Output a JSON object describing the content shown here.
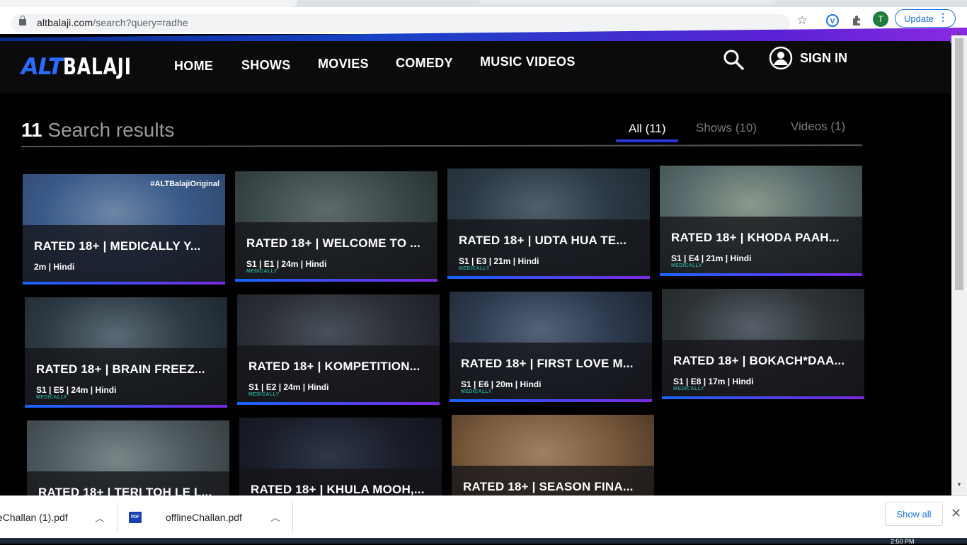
{
  "browser": {
    "url_domain": "altbalaji.com",
    "url_path": "/search?query=radhe",
    "profile_initial": "T",
    "update_label": "Update",
    "menu_dots": "⋮"
  },
  "site": {
    "logo_alt": "ALT",
    "logo_balaji": "BALAJI",
    "nav": [
      "HOME",
      "SHOWS",
      "MOVIES",
      "COMEDY",
      "MUSIC VIDEOS"
    ],
    "sign_in": "SIGN IN"
  },
  "results": {
    "count": "11",
    "label": "Search results",
    "tabs": [
      "All (11)",
      "Shows (10)",
      "Videos (1)"
    ]
  },
  "cards": [
    {
      "title": "RATED 18+ | MEDICALLY Y...",
      "meta": "2m | Hindi",
      "hashtag": "#ALTBalajiOriginal",
      "ribbon": ""
    },
    {
      "title": "RATED 18+ | WELCOME TO ...",
      "meta": "S1 | E1 | 24m | Hindi",
      "hashtag": "",
      "ribbon": "MEDICALLY"
    },
    {
      "title": "RATED 18+ | UDTA HUA TE...",
      "meta": "S1 | E3 | 21m | Hindi",
      "hashtag": "",
      "ribbon": "MEDICALLY"
    },
    {
      "title": "RATED 18+ | KHODA PAAH...",
      "meta": "S1 | E4 | 21m | Hindi",
      "hashtag": "",
      "ribbon": "MEDICALLY"
    },
    {
      "title": "RATED 18+ | BRAIN FREEZ...",
      "meta": "S1 | E5 | 24m | Hindi",
      "hashtag": "",
      "ribbon": "MEDICALLY"
    },
    {
      "title": "RATED 18+ | KOMPETITION...",
      "meta": "S1 | E2 | 24m | Hindi",
      "hashtag": "",
      "ribbon": "MEDICALLY"
    },
    {
      "title": "RATED 18+ | FIRST LOVE M...",
      "meta": "S1 | E6 | 20m | Hindi",
      "hashtag": "",
      "ribbon": "MEDICALLY"
    },
    {
      "title": "RATED 18+ | BOKACH*DAA...",
      "meta": "S1 | E8 | 17m | Hindi",
      "hashtag": "",
      "ribbon": "MEDICALLY"
    },
    {
      "title": "RATED 18+ | TERI TOH LE L...",
      "meta": "",
      "hashtag": "",
      "ribbon": ""
    },
    {
      "title": "RATED 18+ | KHULA MOOH,...",
      "meta": "",
      "hashtag": "",
      "ribbon": ""
    },
    {
      "title": "RATED 18+ | SEASON FINA...",
      "meta": "",
      "hashtag": "",
      "ribbon": ""
    }
  ],
  "downloads": {
    "file1": "eChallan (1).pdf",
    "file2": "offlineChallan.pdf",
    "pdf_badge": "PDF",
    "show_all": "Show all",
    "close": "✕"
  },
  "taskbar": {
    "time": "2:50 PM"
  },
  "colors": {
    "accent": "#2b6cff",
    "gradient_start": "#1565ff",
    "gradient_end": "#7c28e0"
  },
  "icons": [
    "search-icon",
    "user-icon",
    "star-icon",
    "puzzle-icon",
    "lock-icon",
    "pdf-icon",
    "chevron-up-icon",
    "close-icon"
  ]
}
